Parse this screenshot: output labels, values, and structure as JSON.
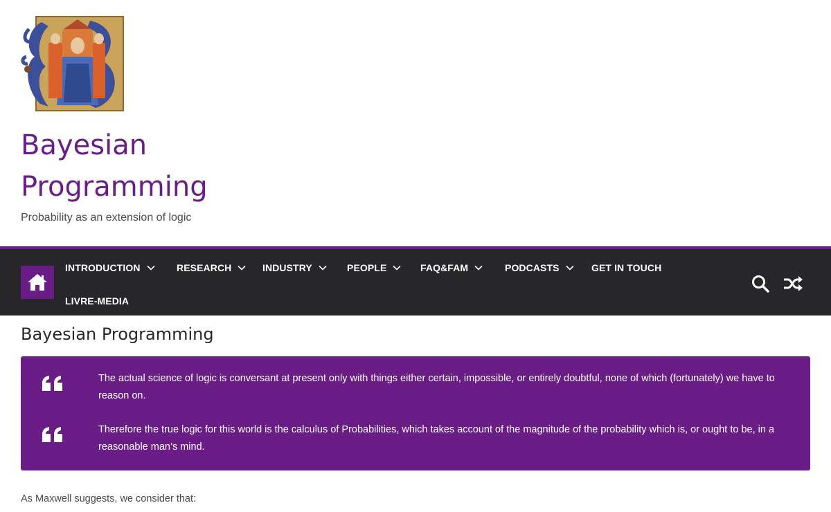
{
  "site": {
    "title": "Bayesian Programming",
    "tagline": "Probability as an extension of logic",
    "accent_color": "#6b1d87",
    "nav_background": "#27272a"
  },
  "nav": {
    "home_icon": "home-icon",
    "items": [
      {
        "label": "INTRODUCTION",
        "has_dropdown": true
      },
      {
        "label": "RESEARCH",
        "has_dropdown": true
      },
      {
        "label": "INDUSTRY",
        "has_dropdown": true
      },
      {
        "label": "PEOPLE",
        "has_dropdown": true
      },
      {
        "label": "FAQ&FAM",
        "has_dropdown": true
      },
      {
        "label": "PODCASTS",
        "has_dropdown": true
      },
      {
        "label": "GET IN TOUCH",
        "has_dropdown": false
      },
      {
        "label": "LIVRE-MEDIA",
        "has_dropdown": false
      }
    ],
    "search_icon": "search-icon",
    "random_icon": "shuffle-icon"
  },
  "main": {
    "page_title": "Bayesian Programming",
    "quotes": [
      {
        "text": "The actual science of logic is conversant at present only with things either certain, impossible, or entirely doubtful, none of which (fortunately) we have to reason on."
      },
      {
        "text": "Therefore the true logic for this world is the calculus of Probabilities, which takes account of the magnitude of the probability which is, or ought to be, in a reasonable man’s mind."
      }
    ],
    "intro_text": "As Maxwell suggests, we consider that:"
  }
}
